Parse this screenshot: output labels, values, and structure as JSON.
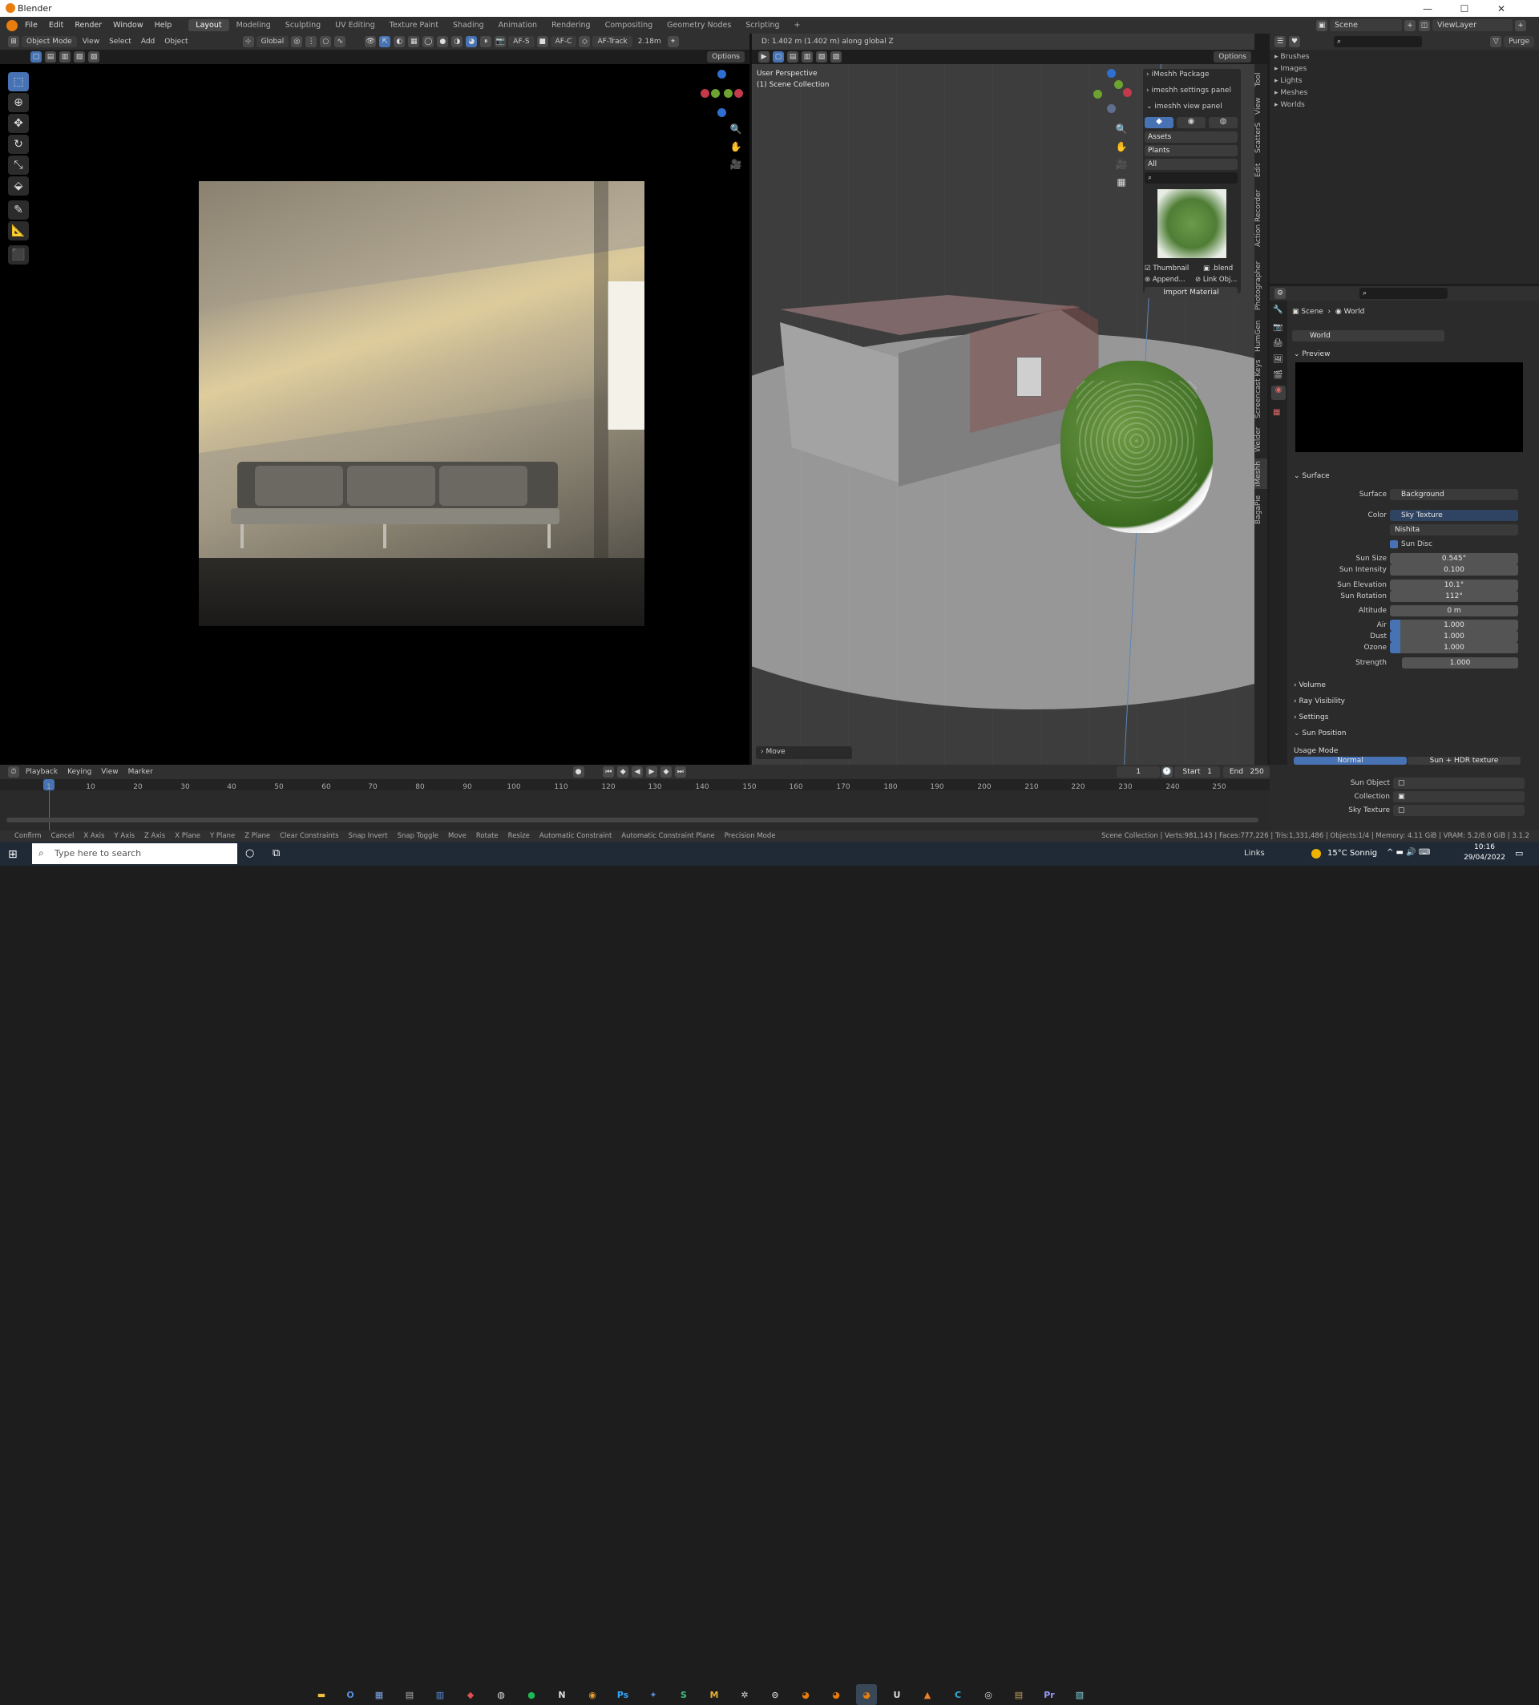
{
  "app": {
    "title": "Blender"
  },
  "menu": [
    "File",
    "Edit",
    "Render",
    "Window",
    "Help"
  ],
  "workspaces": [
    "Layout",
    "Modeling",
    "Sculpting",
    "UV Editing",
    "Texture Paint",
    "Shading",
    "Animation",
    "Rendering",
    "Compositing",
    "Geometry Nodes",
    "Scripting",
    "+"
  ],
  "scene_selector": "Scene",
  "viewlayer_selector": "ViewLayer",
  "header3d": {
    "mode": "Object Mode",
    "view": "View",
    "select": "Select",
    "add": "Add",
    "object": "Object",
    "orientation": "Global",
    "afs": "AF-S",
    "afc": "AF-C",
    "aftrack": "AF-Track",
    "focal": "2.18m",
    "options": "Options"
  },
  "viewport": {
    "status": "D: 1.402 m (1.402 m) along global Z",
    "perspective": "User Perspective",
    "collection": "(1) Scene Collection",
    "options": "Options",
    "move_panel": "Move"
  },
  "imeshh": {
    "package": "iMeshh Package",
    "settings": "imeshh settings panel",
    "view": "imeshh view panel",
    "assets": "Assets",
    "plants": "Plants",
    "all": "All",
    "thumbnail": "Thumbnail",
    "blend": ".blend",
    "append": "Append...",
    "link": "Link Obj...",
    "import": "Import Material"
  },
  "side_tabs": [
    "Tool",
    "View",
    "ScatterS",
    "Edit",
    "Action Recorder",
    "Photographer",
    "HumGen",
    "Screencast Keys",
    "Welder",
    "iMeshh",
    "BagaPie"
  ],
  "outliner": {
    "items": [
      "Brushes",
      "Images",
      "Lights",
      "Meshes",
      "Worlds"
    ],
    "purge": "Purge"
  },
  "props": {
    "breadcrumb_scene": "Scene",
    "breadcrumb_world": "World",
    "world_name": "World",
    "preview": "Preview",
    "surface_section": "Surface",
    "surface_label": "Surface",
    "surface_value": "Background",
    "color_label": "Color",
    "color_value": "Sky Texture",
    "sky_type": "Nishita",
    "sun_disc": "Sun Disc",
    "rows": [
      {
        "label": "Sun Size",
        "value": "0.545°"
      },
      {
        "label": "Sun Intensity",
        "value": "0.100"
      },
      {
        "label": "Sun Elevation",
        "value": "10.1°"
      },
      {
        "label": "Sun Rotation",
        "value": "112°"
      },
      {
        "label": "Altitude",
        "value": "0 m"
      },
      {
        "label": "Air",
        "value": "1.000"
      },
      {
        "label": "Dust",
        "value": "1.000"
      },
      {
        "label": "Ozone",
        "value": "1.000"
      },
      {
        "label": "Strength",
        "value": "1.000"
      }
    ],
    "sections": [
      "Volume",
      "Ray Visibility",
      "Settings",
      "Sun Position"
    ],
    "usage_mode": "Usage Mode",
    "normal": "Normal",
    "sun_hdr": "Sun + HDR texture",
    "sun_object": "Sun Object",
    "collection": "Collection",
    "sky_texture": "Sky Texture"
  },
  "timeline": {
    "playback": "Playback",
    "keying": "Keying",
    "view": "View",
    "marker": "Marker",
    "current": "1",
    "start_label": "Start",
    "start": "1",
    "end_label": "End",
    "end": "250",
    "frames": [
      "1",
      "10",
      "20",
      "30",
      "40",
      "50",
      "60",
      "70",
      "80",
      "90",
      "100",
      "110",
      "120",
      "130",
      "140",
      "150",
      "160",
      "170",
      "180",
      "190",
      "200",
      "210",
      "220",
      "230",
      "240",
      "250"
    ]
  },
  "statusbar": {
    "items": [
      "Confirm",
      "Cancel",
      "X Axis",
      "Y Axis",
      "Z Axis",
      "X Plane",
      "Y Plane",
      "Z Plane",
      "Clear Constraints",
      "Snap Invert",
      "Snap Toggle",
      "Move",
      "Rotate",
      "Resize",
      "Automatic Constraint",
      "Automatic Constraint Plane",
      "Precision Mode"
    ],
    "stats": "Scene Collection | Verts:981,143 | Faces:777,226 | Tris:1,331,486 | Objects:1/4 | Memory: 4.11 GiB | VRAM: 5.2/8.0 GiB | 3.1.2"
  },
  "taskbar": {
    "search_placeholder": "Type here to search",
    "links": "Links",
    "weather": "15°C Sonnig",
    "time": "10:16",
    "date": "29/04/2022"
  },
  "colors": {
    "accent": "#4772b3",
    "active_object": "#e87d0d"
  }
}
